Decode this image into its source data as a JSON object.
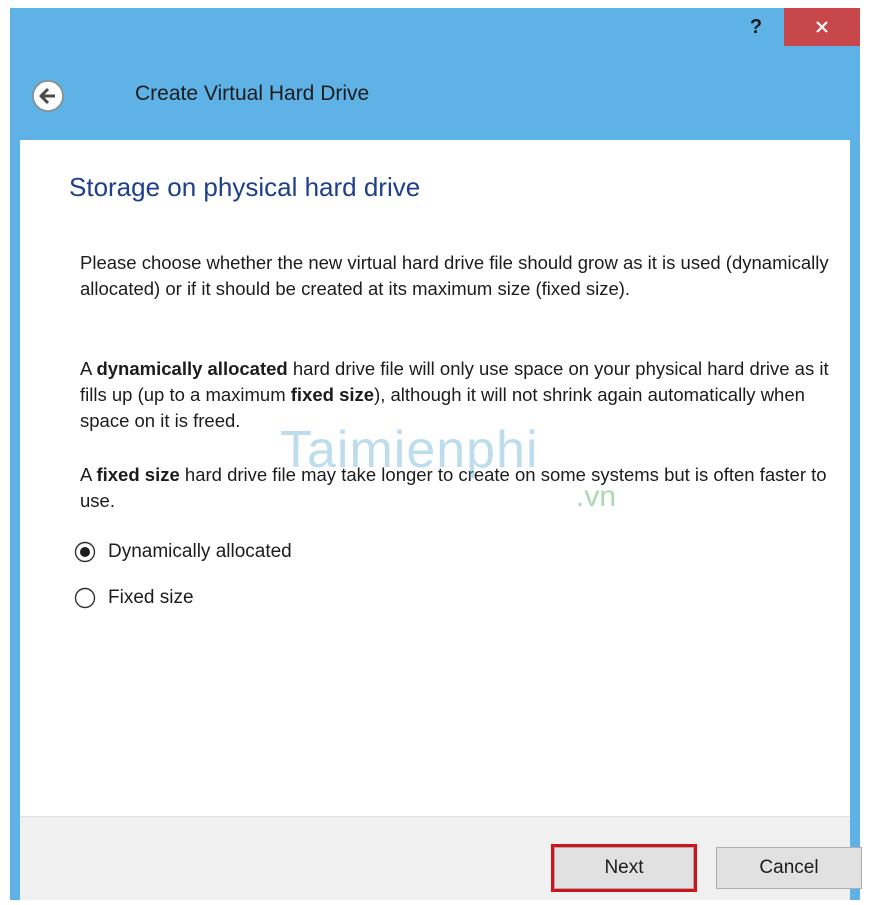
{
  "window": {
    "title": "Create Virtual Hard Drive",
    "help_label": "?",
    "close_label": "✕",
    "colors": {
      "frame": "#5fb2e5",
      "close": "#c7474a",
      "heading": "#1e3f8c",
      "highlight": "#d0141c"
    }
  },
  "page": {
    "heading": "Storage on physical hard drive",
    "para1": "Please choose whether the new virtual hard drive file should grow as it is used (dynamically allocated) or if it should be created at its maximum size (fixed size).",
    "para2": {
      "a": "A ",
      "b": "dynamically allocated",
      "c": " hard drive file will only use space on your physical hard drive as it fills up (up to a maximum ",
      "d": "fixed size",
      "e": "), although it will not shrink again automatically when space on it is freed."
    },
    "para3": {
      "a": "A ",
      "b": "fixed size",
      "c": " hard drive file may take longer to create on some systems but is often faster to use."
    },
    "options": [
      {
        "label": "Dynamically allocated",
        "selected": true
      },
      {
        "label": "Fixed size",
        "selected": false
      }
    ],
    "watermark": "Taimienphi",
    "watermark_sub": ".vn"
  },
  "footer": {
    "next_label": "Next",
    "cancel_label": "Cancel"
  },
  "icons": {
    "back": "back-arrow-icon",
    "close": "close-icon"
  }
}
